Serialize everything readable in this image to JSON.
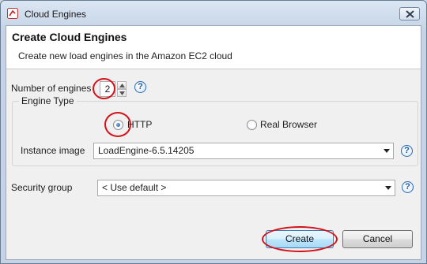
{
  "window": {
    "title": "Cloud Engines",
    "icon": "cloud-engines-app-icon",
    "close_icon": "close-icon"
  },
  "banner": {
    "title": "Create Cloud Engines",
    "description": "Create new load engines in the Amazon EC2 cloud"
  },
  "engines": {
    "label": "Number of engines",
    "value": "2"
  },
  "engine_type": {
    "group_label": "Engine Type",
    "options": [
      {
        "label": "HTTP",
        "checked": true
      },
      {
        "label": "Real Browser",
        "checked": false
      }
    ]
  },
  "instance_image": {
    "label": "Instance image",
    "value": "LoadEngine-6.5.14205"
  },
  "security_group": {
    "label": "Security group",
    "value": "< Use default >"
  },
  "help_glyph": "?",
  "buttons": {
    "create": "Create",
    "cancel": "Cancel"
  },
  "colors": {
    "annotation": "#d4121c",
    "help_icon": "#2a6ab5",
    "default_button": "#3c7fb1"
  }
}
